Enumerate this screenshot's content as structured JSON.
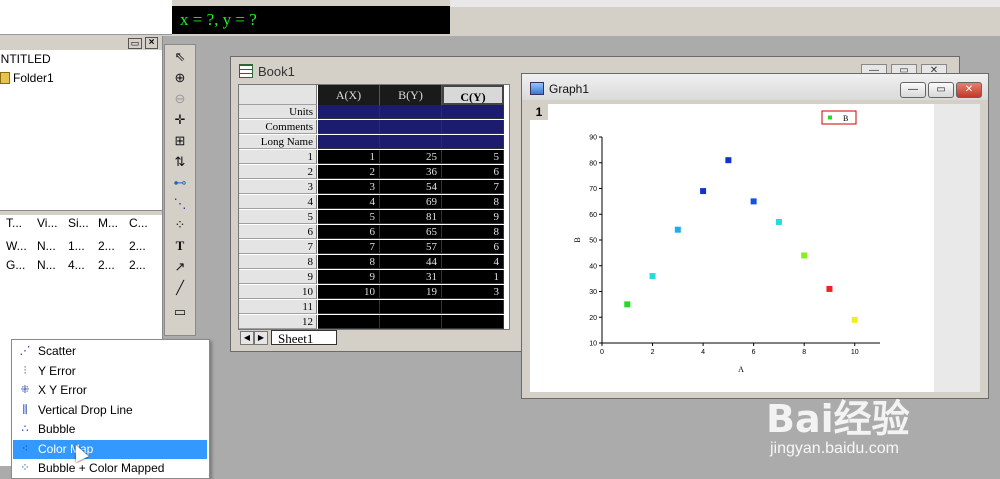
{
  "coord_readout": "x = ?, y = ?",
  "explorer": {
    "root": "UNTITLED",
    "folder": "Folder1",
    "columns": [
      "T...",
      "Vi...",
      "Si...",
      "M...",
      "C..."
    ],
    "rows": [
      [
        "W...",
        "N...",
        "1...",
        "2...",
        "2..."
      ],
      [
        "G...",
        "N...",
        "4...",
        "2...",
        "2..."
      ]
    ]
  },
  "toolbar": {
    "icons": [
      "pointer-icon",
      "zoom-in-icon",
      "zoom-out-icon",
      "screen-reader-icon",
      "data-selector-icon",
      "data-reader-icon",
      "mask-icon",
      "draw-data-icon",
      "regional-data-selector-icon",
      "text-tool-icon",
      "arrow-tool-icon",
      "line-tool-icon",
      "rectangle-tool-icon"
    ]
  },
  "book1": {
    "title": "Book1",
    "columns": [
      "A(X)",
      "B(Y)",
      "C(Y)"
    ],
    "row_labels": [
      "Units",
      "Comments",
      "Long Name"
    ],
    "rows": [
      [
        "1",
        "1",
        "25",
        "5"
      ],
      [
        "2",
        "2",
        "36",
        "6"
      ],
      [
        "3",
        "3",
        "54",
        "7"
      ],
      [
        "4",
        "4",
        "69",
        "8"
      ],
      [
        "5",
        "5",
        "81",
        "9"
      ],
      [
        "6",
        "6",
        "65",
        "8"
      ],
      [
        "7",
        "7",
        "57",
        "6"
      ],
      [
        "8",
        "8",
        "44",
        "4"
      ],
      [
        "9",
        "9",
        "31",
        "1"
      ],
      [
        "10",
        "10",
        "19",
        "3"
      ],
      [
        "11",
        "",
        "",
        ""
      ],
      [
        "12",
        "",
        "",
        ""
      ]
    ],
    "sheet_tab": "Sheet1"
  },
  "graph1": {
    "title": "Graph1",
    "layer": "1",
    "legend": "B"
  },
  "chart_data": {
    "type": "scatter",
    "x": [
      1,
      2,
      3,
      4,
      5,
      6,
      7,
      8,
      9,
      10
    ],
    "y": [
      25,
      36,
      54,
      69,
      81,
      65,
      57,
      44,
      31,
      19
    ],
    "colors": [
      "#22dd22",
      "#22dddd",
      "#22aaee",
      "#1133cc",
      "#1133cc",
      "#1155dd",
      "#22dddd",
      "#88ee22",
      "#ee2222",
      "#eeee22"
    ],
    "xlabel": "A",
    "ylabel": "B",
    "xlim": [
      0,
      11
    ],
    "ylim": [
      10,
      90
    ],
    "xticks": [
      0,
      2,
      4,
      6,
      8,
      10
    ],
    "yticks": [
      10,
      20,
      30,
      40,
      50,
      60,
      70,
      80,
      90
    ],
    "legend": "B",
    "legend_position": "top-right",
    "grid": false
  },
  "menu": {
    "items": [
      {
        "label": "Scatter",
        "icon": "scatter-icon"
      },
      {
        "label": "Y Error",
        "icon": "y-error-icon"
      },
      {
        "label": "X Y Error",
        "icon": "xy-error-icon"
      },
      {
        "label": "Vertical Drop Line",
        "icon": "vertical-drop-line-icon"
      },
      {
        "label": "Bubble",
        "icon": "bubble-icon"
      },
      {
        "label": "Color Map",
        "icon": "color-map-icon"
      },
      {
        "label": "Bubble + Color Mapped",
        "icon": "bubble-color-mapped-icon"
      }
    ],
    "selected_index": 5
  },
  "watermark": {
    "text": "Bai经验",
    "url": "jingyan.baidu.com"
  }
}
